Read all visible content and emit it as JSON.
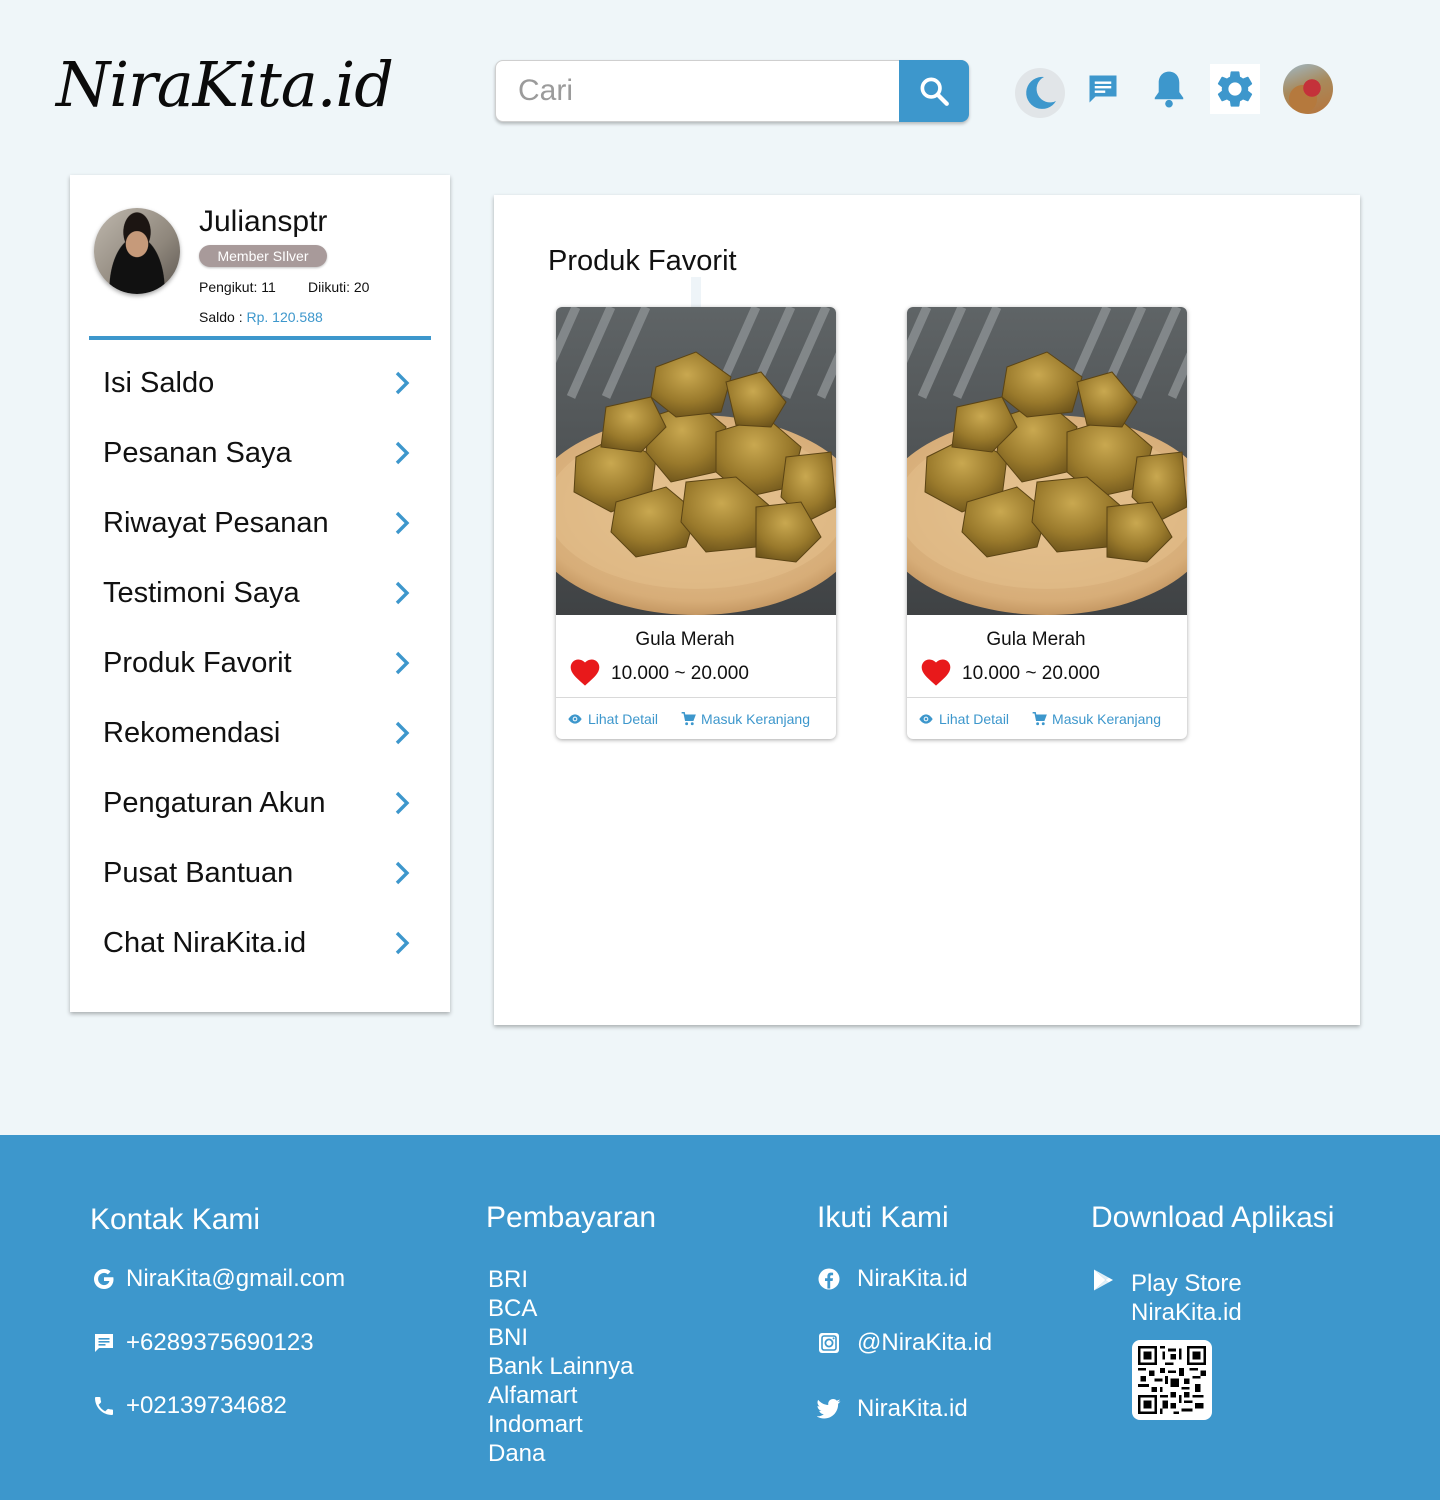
{
  "header": {
    "logo": "NiraKita.id",
    "search_placeholder": "Cari"
  },
  "profile": {
    "name": "Juliansptr",
    "badge": "Member SIlver",
    "followers": "Pengikut: 11",
    "following": "Diikuti: 20",
    "saldo_label": "Saldo : ",
    "saldo_value": "Rp. 120.588"
  },
  "menu": [
    {
      "label": "Isi Saldo"
    },
    {
      "label": "Pesanan Saya"
    },
    {
      "label": "Riwayat Pesanan"
    },
    {
      "label": "Testimoni Saya"
    },
    {
      "label": "Produk Favorit"
    },
    {
      "label": "Rekomendasi"
    },
    {
      "label": "Pengaturan Akun"
    },
    {
      "label": "Pusat Bantuan"
    },
    {
      "label": "Chat NiraKita.id"
    }
  ],
  "main": {
    "title": "Produk Favorit",
    "products": [
      {
        "name": "Gula Merah",
        "price": "10.000 ~ 20.000",
        "detail_label": "Lihat Detail",
        "cart_label": "Masuk Keranjang"
      },
      {
        "name": "Gula Merah",
        "price": "10.000 ~ 20.000",
        "detail_label": "Lihat Detail",
        "cart_label": "Masuk Keranjang"
      }
    ]
  },
  "footer": {
    "contact": {
      "title": "Kontak Kami",
      "email": "NiraKita@gmail.com",
      "whatsapp": "+6289375690123",
      "phone": "+02139734682"
    },
    "payment": {
      "title": "Pembayaran",
      "methods": [
        "BRI",
        "BCA",
        "BNI",
        "Bank Lainnya",
        "Alfamart",
        "Indomart",
        "Dana"
      ]
    },
    "follow": {
      "title": "Ikuti Kami",
      "facebook": "NiraKita.id",
      "instagram": "@NiraKita.id",
      "twitter": "NiraKita.id"
    },
    "download": {
      "title": "Download Aplikasi",
      "store_line1": "Play Store",
      "store_line2": "NiraKita.id"
    }
  },
  "colors": {
    "accent": "#3d97cc",
    "background": "#eff6f9",
    "badge": "#a89a9a",
    "heart": "#e8191b"
  }
}
